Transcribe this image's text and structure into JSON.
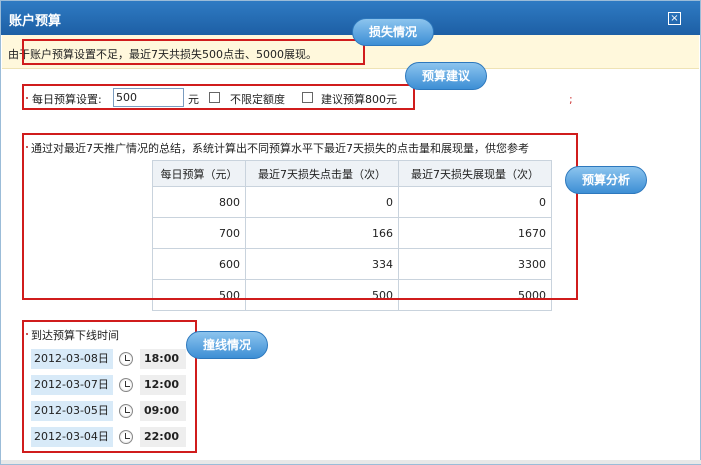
{
  "dialog": {
    "title": "账户预算",
    "close_icon": "close-icon"
  },
  "loss": {
    "text": "由于账户预算设置不足，最近7天共损失500点击、5000展现。",
    "callout": "损失情况"
  },
  "budget": {
    "label": "每日预算设置:",
    "value": "500",
    "unit": "元",
    "unlimited_label": "不限定额度",
    "suggest_label": "建议预算800元",
    "callout": "预算建议",
    "stray_mark": ";"
  },
  "analysis": {
    "intro": "通过对最近7天推广情况的总结，系统计算出不同预算水平下最近7天损失的点击量和展现量，供您参考",
    "callout": "预算分析",
    "headers": [
      "每日预算（元）",
      "最近7天损失点击量（次）",
      "最近7天损失展现量（次）"
    ],
    "rows": [
      [
        "800",
        "0",
        "0"
      ],
      [
        "700",
        "166",
        "1670"
      ],
      [
        "600",
        "334",
        "3300"
      ],
      [
        "500",
        "500",
        "5000"
      ]
    ]
  },
  "offline": {
    "title": "到达预算下线时间",
    "callout": "撞线情况",
    "entries": [
      {
        "date": "2012-03-08日",
        "time": "18:00"
      },
      {
        "date": "2012-03-07日",
        "time": "12:00"
      },
      {
        "date": "2012-03-05日",
        "time": "09:00"
      },
      {
        "date": "2012-03-04日",
        "time": "22:00"
      }
    ]
  },
  "colors": {
    "title_bar": "#2469b3",
    "highlight_box": "#d01c1c",
    "callout": "#4a97d8",
    "notice_bg": "#fff8dc"
  }
}
